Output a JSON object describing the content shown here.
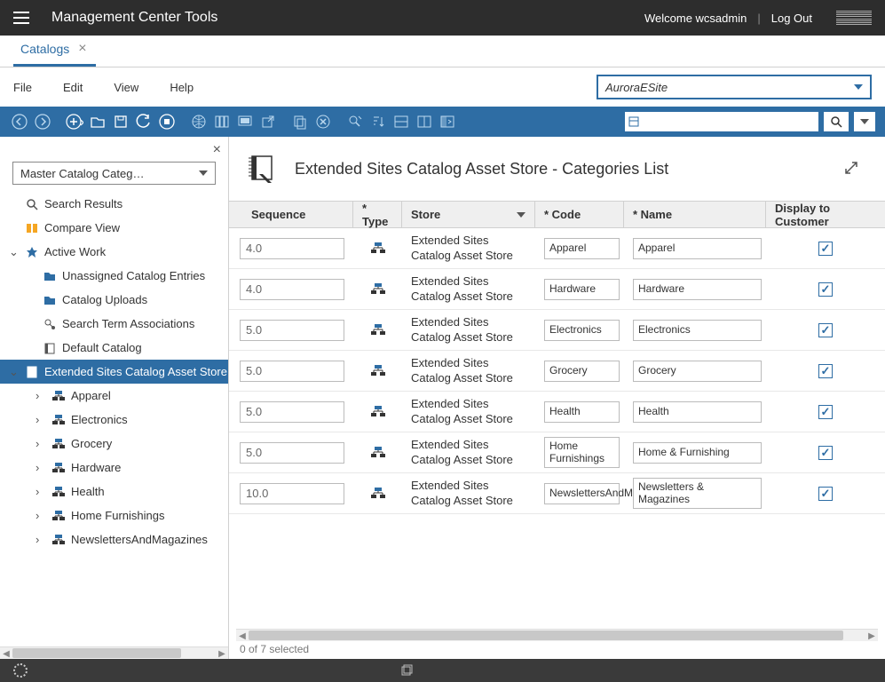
{
  "header": {
    "title": "Management Center Tools",
    "welcome": "Welcome wcsadmin",
    "logout": "Log Out"
  },
  "tabs": [
    {
      "label": "Catalogs"
    }
  ],
  "menubar": {
    "items": [
      "File",
      "Edit",
      "View",
      "Help"
    ],
    "store_selected": "AuroraESite"
  },
  "sidebar": {
    "catalog_selector": "Master Catalog Categ…",
    "items": [
      {
        "label": "Search Results",
        "icon": "search"
      },
      {
        "label": "Compare View",
        "icon": "compare"
      },
      {
        "label": "Active Work",
        "icon": "active",
        "expand": "open"
      },
      {
        "label": "Unassigned Catalog Entries",
        "icon": "folder",
        "indent": 1
      },
      {
        "label": "Catalog Uploads",
        "icon": "folder",
        "indent": 1
      },
      {
        "label": "Search Term Associations",
        "icon": "assoc",
        "indent": 1
      },
      {
        "label": "Default Catalog",
        "icon": "default",
        "indent": 1
      },
      {
        "label": "Extended Sites Catalog Asset Store",
        "icon": "catalog",
        "indent": 0,
        "expand": "open",
        "selected": true
      },
      {
        "label": "Apparel",
        "icon": "category",
        "indent": 2,
        "expand": "closed"
      },
      {
        "label": "Electronics",
        "icon": "category",
        "indent": 2,
        "expand": "closed"
      },
      {
        "label": "Grocery",
        "icon": "category",
        "indent": 2,
        "expand": "closed"
      },
      {
        "label": "Hardware",
        "icon": "category",
        "indent": 2,
        "expand": "closed"
      },
      {
        "label": "Health",
        "icon": "category",
        "indent": 2,
        "expand": "closed"
      },
      {
        "label": "Home Furnishings",
        "icon": "category",
        "indent": 2,
        "expand": "closed"
      },
      {
        "label": "NewslettersAndMagazines",
        "icon": "category",
        "indent": 2,
        "expand": "closed"
      }
    ]
  },
  "content": {
    "title": "Extended Sites Catalog Asset Store - Categories List",
    "columns": {
      "sequence": "Sequence",
      "type": "* Type",
      "store": "Store",
      "code": "* Code",
      "name": "* Name",
      "display": "Display to Customer"
    },
    "rows": [
      {
        "sequence": "4.0",
        "type": "category",
        "store": "Extended Sites Catalog Asset Store",
        "code": "Apparel",
        "name": "Apparel",
        "display": true
      },
      {
        "sequence": "4.0",
        "type": "category",
        "store": "Extended Sites Catalog Asset Store",
        "code": "Hardware",
        "name": "Hardware",
        "display": true
      },
      {
        "sequence": "5.0",
        "type": "category",
        "store": "Extended Sites Catalog Asset Store",
        "code": "Electronics",
        "name": "Electronics",
        "display": true
      },
      {
        "sequence": "5.0",
        "type": "category",
        "store": "Extended Sites Catalog Asset Store",
        "code": "Grocery",
        "name": "Grocery",
        "display": true
      },
      {
        "sequence": "5.0",
        "type": "category",
        "store": "Extended Sites Catalog Asset Store",
        "code": "Health",
        "name": "Health",
        "display": true
      },
      {
        "sequence": "5.0",
        "type": "category",
        "store": "Extended Sites Catalog Asset Store",
        "code": "Home Furnishings",
        "name": "Home & Furnishing",
        "display": true
      },
      {
        "sequence": "10.0",
        "type": "category",
        "store": "Extended Sites Catalog Asset Store",
        "code": "NewslettersAndMagazines",
        "name": "Newsletters & Magazines",
        "display": true
      }
    ],
    "status": "0 of 7 selected"
  }
}
